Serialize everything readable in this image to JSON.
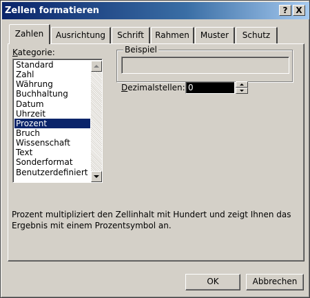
{
  "window": {
    "title": "Zellen formatieren",
    "help_button": "?",
    "close_button": "X"
  },
  "tabs": [
    {
      "label": "Zahlen",
      "active": true
    },
    {
      "label": "Ausrichtung",
      "active": false
    },
    {
      "label": "Schrift",
      "active": false
    },
    {
      "label": "Rahmen",
      "active": false
    },
    {
      "label": "Muster",
      "active": false
    },
    {
      "label": "Schutz",
      "active": false
    }
  ],
  "category": {
    "label_prefix": "K",
    "label_rest": "ategorie:",
    "items": [
      "Standard",
      "Zahl",
      "Währung",
      "Buchhaltung",
      "Datum",
      "Uhrzeit",
      "Prozent",
      "Bruch",
      "Wissenschaft",
      "Text",
      "Sonderformat",
      "Benutzerdefiniert"
    ],
    "selected": "Prozent"
  },
  "example": {
    "label": "Beispiel",
    "value": ""
  },
  "decimals": {
    "label_prefix": "D",
    "label_rest": "ezimalstellen:",
    "value": "0"
  },
  "description": "Prozent multipliziert den Zellinhalt mit Hundert und zeigt Ihnen das Ergebnis mit einem Prozentsymbol an.",
  "buttons": {
    "ok": "OK",
    "cancel": "Abbrechen"
  },
  "colors": {
    "selection": "#0a246a",
    "title_start": "#0a246a",
    "face": "#d4d0c8"
  }
}
